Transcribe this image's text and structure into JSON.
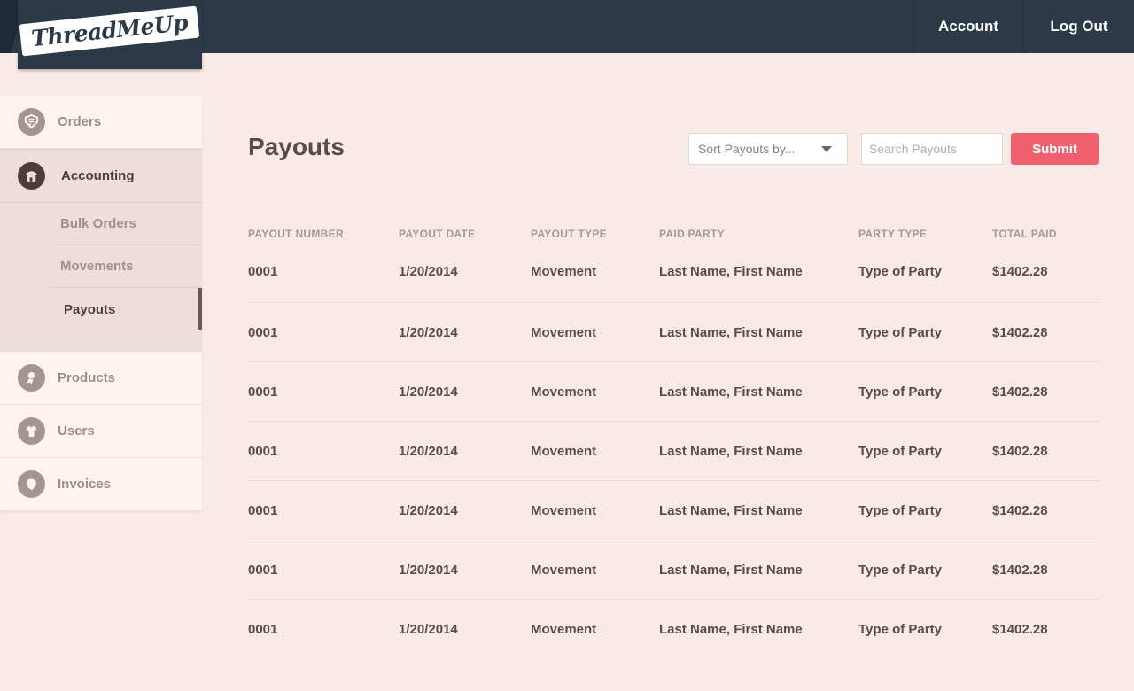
{
  "brand": {
    "name": "ThreadMeUp"
  },
  "top_nav": {
    "account": "Account",
    "logout": "Log Out"
  },
  "sidebar": {
    "items_before": [
      {
        "label": "Orders",
        "icon": "orders-icon"
      }
    ],
    "active_section": {
      "label": "Accounting",
      "icon": "accounting-icon",
      "sub_items": [
        {
          "label": "Bulk Orders",
          "active": false
        },
        {
          "label": "Movements",
          "active": false
        },
        {
          "label": "Payouts",
          "active": true
        }
      ]
    },
    "items_after": [
      {
        "label": "Products",
        "icon": "products-icon"
      },
      {
        "label": "Users",
        "icon": "users-icon"
      },
      {
        "label": "Invoices",
        "icon": "invoices-icon"
      }
    ]
  },
  "main": {
    "title": "Payouts",
    "sort_select": {
      "value": "Sort Payouts by..."
    },
    "search": {
      "placeholder": "Search Payouts",
      "value": ""
    },
    "submit_label": "Submit"
  },
  "table": {
    "columns": [
      "PAYOUT NUMBER",
      "PAYOUT DATE",
      "PAYOUT TYPE",
      "PAID PARTY",
      "PARTY TYPE",
      "TOTAL PAID"
    ],
    "rows": [
      [
        "0001",
        "1/20/2014",
        "Movement",
        "Last Name, First Name",
        "Type of Party",
        "$1402.28"
      ],
      [
        "0001",
        "1/20/2014",
        "Movement",
        "Last Name, First Name",
        "Type of Party",
        "$1402.28"
      ],
      [
        "0001",
        "1/20/2014",
        "Movement",
        "Last Name, First Name",
        "Type of Party",
        "$1402.28"
      ],
      [
        "0001",
        "1/20/2014",
        "Movement",
        "Last Name, First Name",
        "Type of Party",
        "$1402.28"
      ],
      [
        "0001",
        "1/20/2014",
        "Movement",
        "Last Name, First Name",
        "Type of Party",
        "$1402.28"
      ],
      [
        "0001",
        "1/20/2014",
        "Movement",
        "Last Name, First Name",
        "Type of Party",
        "$1402.28"
      ],
      [
        "0001",
        "1/20/2014",
        "Movement",
        "Last Name, First Name",
        "Type of Party",
        "$1402.28"
      ]
    ]
  },
  "colors": {
    "topbar": "#2c3a47",
    "background": "#f8ebe7",
    "accent": "#f0606e",
    "text": "#5a4a48"
  }
}
